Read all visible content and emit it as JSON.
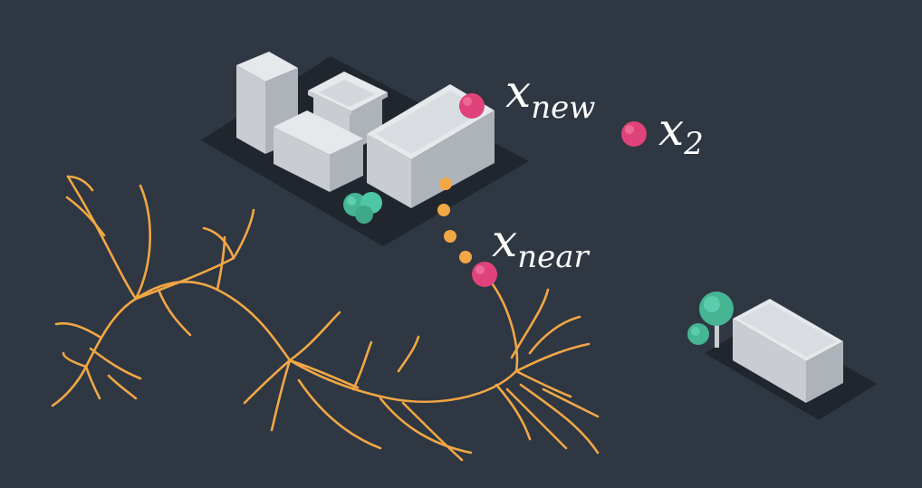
{
  "colors": {
    "background": "#2e3742",
    "tree_branch": "#f2a745",
    "node": "#e0437a",
    "path_dot": "#f2a745",
    "foliage": "#4fc7a4",
    "building_top": "#e6e9ec",
    "building_left": "#c9cdd2",
    "building_right": "#aeb3b9",
    "shadow": "#1f262e"
  },
  "labels": {
    "x_new": {
      "main": "x",
      "sub": "new"
    },
    "x_2": {
      "main": "x",
      "sub": "2"
    },
    "x_near": {
      "main": "x",
      "sub": "near"
    }
  },
  "icons": [
    "building-icon",
    "tree-icon",
    "bush-icon"
  ]
}
